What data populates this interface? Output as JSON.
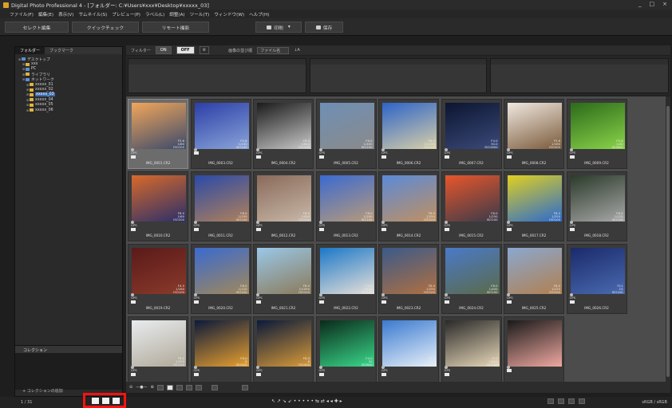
{
  "window": {
    "title": "Digital Photo Professional 4 - [フォルダー: C:¥Users¥xxx¥Desktop¥xxxxx_03]",
    "controls": [
      "_",
      "□",
      "×"
    ]
  },
  "menu": [
    "ファイル(F)",
    "編集(E)",
    "表示(V)",
    "サムネイル(S)",
    "プレビュー(P)",
    "ラベル(L)",
    "調整(A)",
    "ツール(T)",
    "ウィンドウ(W)",
    "ヘルプ(H)"
  ],
  "toolbar": {
    "select_edit": "セレクト編集",
    "quick_check": "クイックチェック",
    "remote": "リモート撮影",
    "print": "印刷",
    "save": "保存"
  },
  "left_panel": {
    "tabs": [
      "フォルダー",
      "ブックマーク"
    ],
    "tree": [
      {
        "label": "デスクトップ",
        "indent": 0,
        "icon": "blue"
      },
      {
        "label": "xxx",
        "indent": 1,
        "icon": "folder"
      },
      {
        "label": "PC",
        "indent": 1,
        "icon": "blue"
      },
      {
        "label": "ライブラリ",
        "indent": 1,
        "icon": "folder"
      },
      {
        "label": "ネットワーク",
        "indent": 1,
        "icon": "blue"
      },
      {
        "label": "xxxxx_01",
        "indent": 2,
        "icon": "folder"
      },
      {
        "label": "xxxxx_02",
        "indent": 2,
        "icon": "folder"
      },
      {
        "label": "xxxxx_03",
        "indent": 2,
        "icon": "folder",
        "selected": true
      },
      {
        "label": "xxxxx_04",
        "indent": 2,
        "icon": "folder"
      },
      {
        "label": "xxxxx_05",
        "indent": 2,
        "icon": "folder"
      },
      {
        "label": "xxxxx_06",
        "indent": 2,
        "icon": "folder"
      }
    ],
    "collection_title": "コレクション",
    "add_collection": "+ コレクションの追加"
  },
  "filter": {
    "label": "フィルター",
    "on": "ON",
    "off": "OFF",
    "sort_label": "画像の並び順",
    "sort_value": "ファイル名"
  },
  "thumbnails": [
    {
      "name": "IMG_0001.CR2",
      "meta": [
        "F5.6",
        "1/60",
        "ISO100"
      ],
      "colors": [
        "#f2a65a",
        "#3b4a6b"
      ],
      "gps": true,
      "selected": true
    },
    {
      "name": "IMG_0003.CR2",
      "meta": [
        "F5.6",
        "1/100",
        "ISO100"
      ],
      "colors": [
        "#2b3fa8",
        "#8aa4d8"
      ],
      "gps": false
    },
    {
      "name": "IMG_0004.CR2",
      "meta": [
        "F8.0",
        "1/640",
        "ISO100"
      ],
      "colors": [
        "#1b1b1b",
        "#c9c9c9"
      ],
      "gps": true
    },
    {
      "name": "IMG_0005.CR2",
      "meta": [
        "F8.0",
        "1/400",
        "ISO100"
      ],
      "colors": [
        "#6e8fb5",
        "#8a8a8a"
      ],
      "gps": true
    },
    {
      "name": "IMG_0006.CR2",
      "meta": [
        "F8.0",
        "1/1250",
        "ISO100"
      ],
      "colors": [
        "#2d64c8",
        "#d8cfa8"
      ],
      "gps": true
    },
    {
      "name": "IMG_0007.CR2",
      "meta": [
        "F4.0",
        "30.0",
        "ISO1600"
      ],
      "colors": [
        "#0c1530",
        "#3a4a7a"
      ],
      "gps": true
    },
    {
      "name": "IMG_0008.CR2",
      "meta": [
        "F5.6",
        "1/160",
        "ISO200"
      ],
      "colors": [
        "#f0e8e0",
        "#7a5a3a"
      ],
      "gps": true
    },
    {
      "name": "IMG_0009.CR2",
      "meta": [
        "F5.6",
        "1/40",
        "ISO800"
      ],
      "colors": [
        "#2c6a1a",
        "#8ad44a"
      ],
      "gps": true
    },
    {
      "name": "IMG_0010.CR2",
      "meta": [
        "F8.0",
        "1/60",
        "ISO100"
      ],
      "colors": [
        "#d86a2a",
        "#2a2f6a"
      ],
      "gps": true
    },
    {
      "name": "IMG_0011.CR2",
      "meta": [
        "F8.0",
        "1/250",
        "ISO100"
      ],
      "colors": [
        "#2a4aa8",
        "#b0805a"
      ],
      "gps": true
    },
    {
      "name": "IMG_0012.CR2",
      "meta": [
        "F8.0",
        "1/500",
        "ISO100"
      ],
      "colors": [
        "#8a6a5a",
        "#c8b8a8"
      ],
      "gps": true
    },
    {
      "name": "IMG_0013.CR2",
      "meta": [
        "F8.0",
        "1/200",
        "ISO100"
      ],
      "colors": [
        "#3a6ad0",
        "#b89a7a"
      ],
      "gps": true
    },
    {
      "name": "IMG_0014.CR2",
      "meta": [
        "F8.0",
        "1/250",
        "ISO100"
      ],
      "colors": [
        "#5a8ad8",
        "#c09060"
      ],
      "gps": true
    },
    {
      "name": "IMG_0015.CR2",
      "meta": [
        "F8.0",
        "1/250",
        "ISO100"
      ],
      "colors": [
        "#e8562a",
        "#3a3a4a"
      ],
      "gps": true
    },
    {
      "name": "IMG_0017.CR2",
      "meta": [
        "F8.0",
        "1/250",
        "ISO100"
      ],
      "colors": [
        "#e0d020",
        "#2a6ad0"
      ],
      "gps": true
    },
    {
      "name": "IMG_0018.CR2",
      "meta": [
        "F8.0",
        "1/125",
        "ISO100"
      ],
      "colors": [
        "#2a3a2a",
        "#a8a8a8"
      ],
      "gps": true
    },
    {
      "name": "IMG_0019.CR2",
      "meta": [
        "F4.5",
        "1/160",
        "ISO100"
      ],
      "colors": [
        "#5a1a1a",
        "#8a3a2a"
      ],
      "gps": true
    },
    {
      "name": "IMG_0020.CR2",
      "meta": [
        "F8.0",
        "1/120",
        "ISO100"
      ],
      "colors": [
        "#3a6ad0",
        "#a0885a"
      ],
      "gps": true
    },
    {
      "name": "IMG_0021.CR2",
      "meta": [
        "F8.0",
        "1/1000",
        "ISO100"
      ],
      "colors": [
        "#9ac8e8",
        "#8a7a5a"
      ],
      "gps": true
    },
    {
      "name": "IMG_0022.CR2",
      "meta": [
        "F5.6",
        "1/640",
        "ISO100"
      ],
      "colors": [
        "#1a78c8",
        "#e8e0d8"
      ],
      "gps": true
    },
    {
      "name": "IMG_0023.CR2",
      "meta": [
        "F8.0",
        "1/250",
        "ISO100"
      ],
      "colors": [
        "#3a5a8a",
        "#b07040"
      ],
      "gps": true
    },
    {
      "name": "IMG_0024.CR2",
      "meta": [
        "F8.0",
        "1/400",
        "ISO100"
      ],
      "colors": [
        "#4a7ac8",
        "#5a6a4a"
      ],
      "gps": true
    },
    {
      "name": "IMG_0025.CR2",
      "meta": [
        "F8.0",
        "1/125",
        "ISO100"
      ],
      "colors": [
        "#8aa8d0",
        "#b08050"
      ],
      "gps": true
    },
    {
      "name": "IMG_0026.CR2",
      "meta": [
        "F11",
        "15",
        "ISO100"
      ],
      "colors": [
        "#1a2a6a",
        "#4a6ab0"
      ],
      "gps": true
    },
    {
      "name": "",
      "meta": [
        "F8.0",
        "1/320",
        "ISO100"
      ],
      "colors": [
        "#e8ecef",
        "#b0a898"
      ],
      "gps": true
    },
    {
      "name": "",
      "meta": [
        "F8.0",
        "8",
        "ISO400"
      ],
      "colors": [
        "#0c1a3a",
        "#e8a030"
      ],
      "gps": true
    },
    {
      "name": "",
      "meta": [
        "F8.0",
        "8",
        "ISO400"
      ],
      "colors": [
        "#0a1a3a",
        "#d89a3a"
      ],
      "gps": true
    },
    {
      "name": "",
      "meta": [
        "F4.0",
        "30",
        "ISO800"
      ],
      "colors": [
        "#0a2a1a",
        "#3ad88a"
      ],
      "gps": true
    },
    {
      "name": "",
      "meta": [
        "F8.0",
        "1/250",
        "ISO100"
      ],
      "colors": [
        "#3a7ad0",
        "#e8f0f8"
      ],
      "gps": true
    },
    {
      "name": "",
      "meta": [
        "F11",
        "1/800",
        "ISO100"
      ],
      "colors": [
        "#2a2a2a",
        "#e8d8b8"
      ],
      "gps": true
    },
    {
      "name": "",
      "meta": [],
      "colors": [
        "#1a1a1a",
        "#f0a8a0"
      ],
      "gps": false
    }
  ],
  "status": {
    "count": "1 / 31",
    "color_space": "sRGB / sRGB",
    "nav_symbols": "↖ ↗ ↘ ↙ • • • • • ⇆ ⇄ ◂ ◂ ✚ ▸"
  }
}
